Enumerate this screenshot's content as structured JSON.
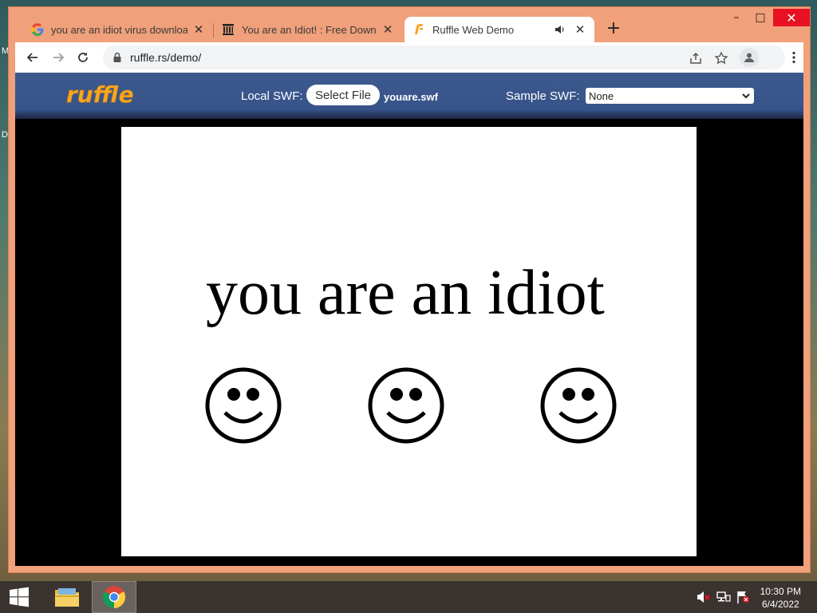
{
  "desktop": {
    "left_fragments": [
      "M",
      "D"
    ]
  },
  "browser": {
    "tabs": [
      {
        "title": "you are an idiot virus download",
        "favicon": "google-g-icon",
        "active": false
      },
      {
        "title": "You are an Idiot! : Free Download",
        "favicon": "archive-building-icon",
        "active": false
      },
      {
        "title": "Ruffle Web Demo",
        "favicon": "ruffle-icon",
        "active": true,
        "audio": true
      }
    ],
    "new_tab_label": "+",
    "window_controls": {
      "minimize": "–",
      "maximize": "□",
      "close": "✕"
    },
    "url": "ruffle.rs/demo/",
    "omnibox_icons": [
      "lock-icon",
      "share-icon",
      "star-icon",
      "profile-icon",
      "menu-icon"
    ]
  },
  "ruffle": {
    "logo_text": "ruffle",
    "local_swf_label": "Local SWF:",
    "select_file_label": "Select File",
    "file_name": "youare.swf",
    "sample_swf_label": "Sample SWF:",
    "sample_selected": "None"
  },
  "stage": {
    "text": "you are an idiot",
    "smiley_count": 3
  },
  "taskbar": {
    "time": "10:30 PM",
    "date": "6/4/2022",
    "apps": [
      "file-explorer-icon",
      "chrome-icon"
    ]
  },
  "colors": {
    "window_frame": "#f0a07a",
    "ruffle_header": "#37538a",
    "ruffle_logo": "#f6a623",
    "close_red": "#e81123"
  }
}
